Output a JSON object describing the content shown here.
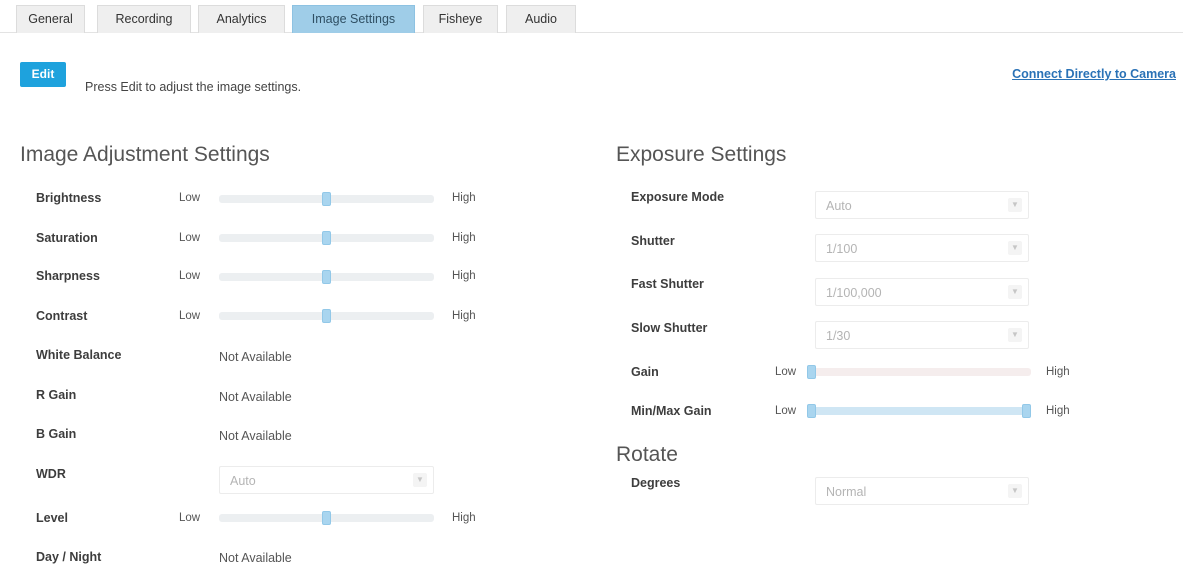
{
  "tabs": [
    {
      "label": "General"
    },
    {
      "label": "Recording"
    },
    {
      "label": "Analytics"
    },
    {
      "label": "Image Settings"
    },
    {
      "label": "Fisheye"
    },
    {
      "label": "Audio"
    }
  ],
  "active_tab": "Image Settings",
  "toolbar": {
    "edit_label": "Edit",
    "hint": "Press Edit to adjust the image settings.",
    "connect_link": "Connect Directly to Camera"
  },
  "image_adjustment": {
    "title": "Image Adjustment Settings",
    "low_label": "Low",
    "high_label": "High",
    "brightness": {
      "label": "Brightness",
      "value": 0.5
    },
    "saturation": {
      "label": "Saturation",
      "value": 0.5
    },
    "sharpness": {
      "label": "Sharpness",
      "value": 0.5
    },
    "contrast": {
      "label": "Contrast",
      "value": 0.5
    },
    "white_balance": {
      "label": "White Balance",
      "value": "Not Available"
    },
    "r_gain": {
      "label": "R Gain",
      "value": "Not Available"
    },
    "b_gain": {
      "label": "B Gain",
      "value": "Not Available"
    },
    "wdr": {
      "label": "WDR",
      "value": "Auto"
    },
    "level": {
      "label": "Level",
      "value": 0.5
    },
    "day_night": {
      "label": "Day / Night",
      "value": "Not Available"
    }
  },
  "exposure": {
    "title": "Exposure Settings",
    "low_label": "Low",
    "high_label": "High",
    "mode": {
      "label": "Exposure Mode",
      "value": "Auto"
    },
    "shutter": {
      "label": "Shutter",
      "value": "1/100"
    },
    "fast_shutter": {
      "label": "Fast Shutter",
      "value": "1/100,000"
    },
    "slow_shutter": {
      "label": "Slow Shutter",
      "value": "1/30"
    },
    "gain": {
      "label": "Gain",
      "value": 0.0
    },
    "min_max_gain": {
      "label": "Min/Max Gain",
      "min": 0.0,
      "max": 1.0
    }
  },
  "rotate": {
    "title": "Rotate",
    "degrees": {
      "label": "Degrees",
      "value": "Normal"
    }
  },
  "colors": {
    "accent": "#1ea2dd",
    "active_tab": "#9fcde8",
    "link": "#2a72b6"
  },
  "icons": {
    "dropdown": "chevron-down-icon"
  }
}
